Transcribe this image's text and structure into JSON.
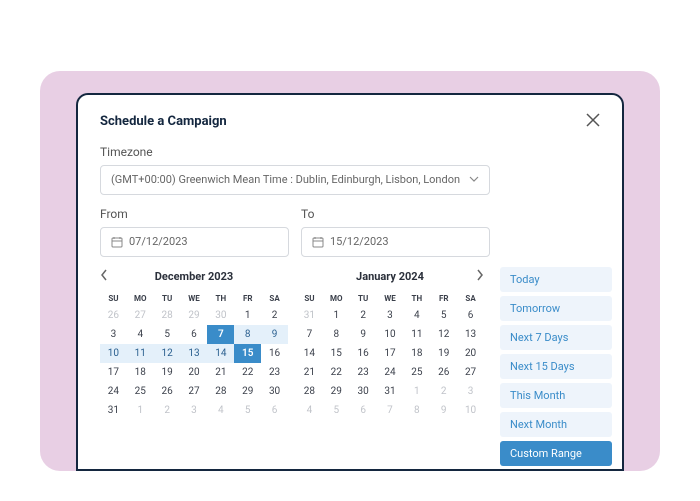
{
  "modal": {
    "title": "Schedule a Campaign"
  },
  "timezone": {
    "label": "Timezone",
    "value": "(GMT+00:00) Greenwich Mean Time : Dublin, Edinburgh, Lisbon, London"
  },
  "from": {
    "label": "From",
    "value": "07/12/2023"
  },
  "to": {
    "label": "To",
    "value": "15/12/2023"
  },
  "cal1": {
    "title": "December 2023",
    "dow": [
      "SU",
      "MO",
      "TU",
      "WE",
      "TH",
      "FR",
      "SA"
    ],
    "weeks": [
      [
        {
          "n": 26,
          "s": "m"
        },
        {
          "n": 27,
          "s": "m"
        },
        {
          "n": 28,
          "s": "m"
        },
        {
          "n": 29,
          "s": "m"
        },
        {
          "n": 30,
          "s": "m"
        },
        {
          "n": 1,
          "s": ""
        },
        {
          "n": 2,
          "s": ""
        }
      ],
      [
        {
          "n": 3,
          "s": ""
        },
        {
          "n": 4,
          "s": ""
        },
        {
          "n": 5,
          "s": ""
        },
        {
          "n": 6,
          "s": ""
        },
        {
          "n": 7,
          "s": "sel"
        },
        {
          "n": 8,
          "s": "r"
        },
        {
          "n": 9,
          "s": "r"
        }
      ],
      [
        {
          "n": 10,
          "s": "r"
        },
        {
          "n": 11,
          "s": "r"
        },
        {
          "n": 12,
          "s": "r"
        },
        {
          "n": 13,
          "s": "r"
        },
        {
          "n": 14,
          "s": "r"
        },
        {
          "n": 15,
          "s": "sel"
        },
        {
          "n": 16,
          "s": ""
        }
      ],
      [
        {
          "n": 17,
          "s": ""
        },
        {
          "n": 18,
          "s": ""
        },
        {
          "n": 19,
          "s": ""
        },
        {
          "n": 20,
          "s": ""
        },
        {
          "n": 21,
          "s": ""
        },
        {
          "n": 22,
          "s": ""
        },
        {
          "n": 23,
          "s": ""
        }
      ],
      [
        {
          "n": 24,
          "s": ""
        },
        {
          "n": 25,
          "s": ""
        },
        {
          "n": 26,
          "s": ""
        },
        {
          "n": 27,
          "s": ""
        },
        {
          "n": 28,
          "s": ""
        },
        {
          "n": 29,
          "s": ""
        },
        {
          "n": 30,
          "s": ""
        }
      ],
      [
        {
          "n": 31,
          "s": ""
        },
        {
          "n": 1,
          "s": "m"
        },
        {
          "n": 2,
          "s": "m"
        },
        {
          "n": 3,
          "s": "m"
        },
        {
          "n": 4,
          "s": "m"
        },
        {
          "n": 5,
          "s": "m"
        },
        {
          "n": 6,
          "s": "m"
        }
      ]
    ]
  },
  "cal2": {
    "title": "January 2024",
    "dow": [
      "SU",
      "MO",
      "TU",
      "WE",
      "TH",
      "FR",
      "SA"
    ],
    "weeks": [
      [
        {
          "n": 31,
          "s": "m"
        },
        {
          "n": 1,
          "s": ""
        },
        {
          "n": 2,
          "s": ""
        },
        {
          "n": 3,
          "s": ""
        },
        {
          "n": 4,
          "s": ""
        },
        {
          "n": 5,
          "s": ""
        },
        {
          "n": 6,
          "s": ""
        }
      ],
      [
        {
          "n": 7,
          "s": ""
        },
        {
          "n": 8,
          "s": ""
        },
        {
          "n": 9,
          "s": ""
        },
        {
          "n": 10,
          "s": ""
        },
        {
          "n": 11,
          "s": ""
        },
        {
          "n": 12,
          "s": ""
        },
        {
          "n": 13,
          "s": ""
        }
      ],
      [
        {
          "n": 14,
          "s": ""
        },
        {
          "n": 15,
          "s": ""
        },
        {
          "n": 16,
          "s": ""
        },
        {
          "n": 17,
          "s": ""
        },
        {
          "n": 18,
          "s": ""
        },
        {
          "n": 19,
          "s": ""
        },
        {
          "n": 20,
          "s": ""
        }
      ],
      [
        {
          "n": 21,
          "s": ""
        },
        {
          "n": 22,
          "s": ""
        },
        {
          "n": 23,
          "s": ""
        },
        {
          "n": 24,
          "s": ""
        },
        {
          "n": 25,
          "s": ""
        },
        {
          "n": 26,
          "s": ""
        },
        {
          "n": 27,
          "s": ""
        }
      ],
      [
        {
          "n": 28,
          "s": ""
        },
        {
          "n": 29,
          "s": ""
        },
        {
          "n": 30,
          "s": ""
        },
        {
          "n": 31,
          "s": ""
        },
        {
          "n": 1,
          "s": "m"
        },
        {
          "n": 2,
          "s": "m"
        },
        {
          "n": 3,
          "s": "m"
        }
      ],
      [
        {
          "n": 4,
          "s": "m"
        },
        {
          "n": 5,
          "s": "m"
        },
        {
          "n": 6,
          "s": "m"
        },
        {
          "n": 7,
          "s": "m"
        },
        {
          "n": 8,
          "s": "m"
        },
        {
          "n": 9,
          "s": "m"
        },
        {
          "n": 10,
          "s": "m"
        }
      ]
    ]
  },
  "presets": [
    {
      "label": "Today",
      "active": false
    },
    {
      "label": "Tomorrow",
      "active": false
    },
    {
      "label": "Next 7 Days",
      "active": false
    },
    {
      "label": "Next 15 Days",
      "active": false
    },
    {
      "label": "This Month",
      "active": false
    },
    {
      "label": "Next Month",
      "active": false
    },
    {
      "label": "Custom Range",
      "active": true
    }
  ]
}
